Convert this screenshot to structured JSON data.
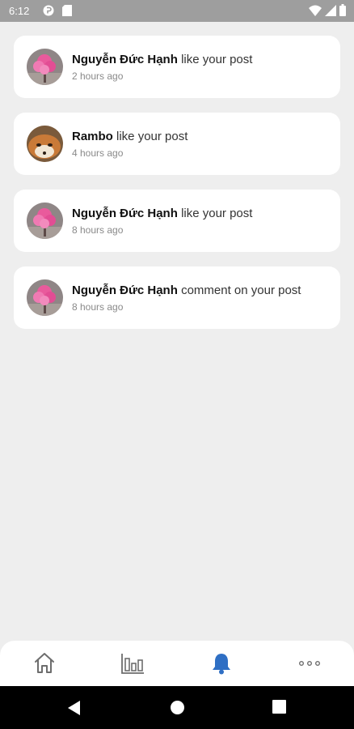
{
  "status_bar": {
    "time": "6:12",
    "left_icons": [
      "app-icon",
      "sd-card-icon"
    ],
    "right_icons": [
      "wifi-icon",
      "signal-icon",
      "battery-icon"
    ]
  },
  "notifications": [
    {
      "name": "Nguyễn Đức Hạnh",
      "action": "like your post",
      "time": "2 hours ago",
      "avatar": "pink-flower-avatar"
    },
    {
      "name": "Rambo",
      "action": "like your post",
      "time": "4 hours ago",
      "avatar": "fox-avatar"
    },
    {
      "name": "Nguyễn Đức Hạnh",
      "action": "like your post",
      "time": "8 hours ago",
      "avatar": "pink-flower-avatar"
    },
    {
      "name": "Nguyễn Đức Hạnh",
      "action": "comment on your post",
      "time": "8 hours ago",
      "avatar": "pink-flower-avatar"
    }
  ],
  "bottom_nav": {
    "items": [
      "home-icon",
      "stats-icon",
      "bell-icon",
      "more-icon"
    ],
    "active": "bell-icon",
    "active_color": "#2f6fc4",
    "inactive_color": "#6d6d6d"
  },
  "system_nav": [
    "back-icon",
    "home-circle-icon",
    "recents-icon"
  ]
}
